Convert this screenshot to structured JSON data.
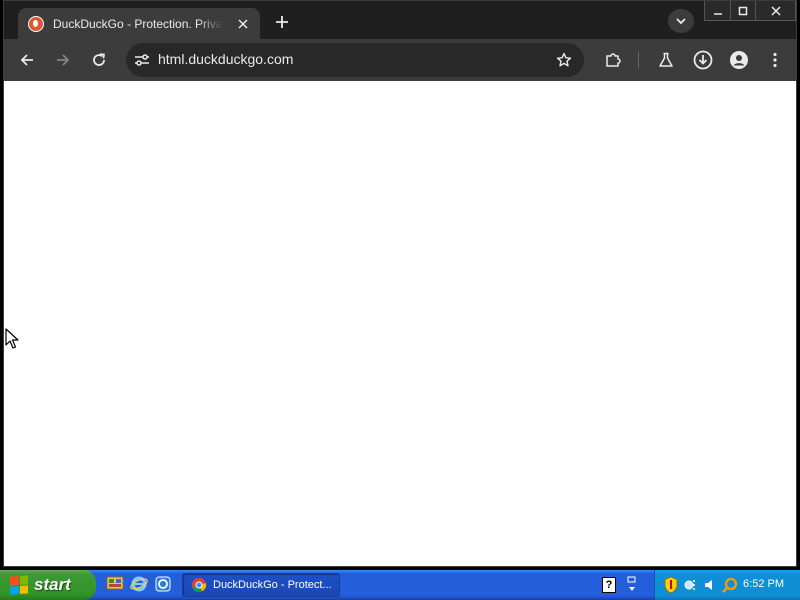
{
  "browser": {
    "tab": {
      "title": "DuckDuckGo - Protection. Privacy. Peace of mind.",
      "favicon": "duckduckgo-logo-icon",
      "brand_color": "#de5833"
    },
    "url": "html.duckduckgo.com",
    "toolbar_icons": [
      "back-arrow-icon",
      "forward-arrow-icon",
      "reload-icon",
      "site-info-icon",
      "bookmark-star-icon",
      "extensions-puzzle-icon",
      "labs-flask-icon",
      "download-icon",
      "profile-icon",
      "menu-kebab-icon"
    ],
    "colors": {
      "tabstrip": "#1f1f1f",
      "toolbar": "#3c3c3c",
      "omnibox": "#282828",
      "text": "#e8eaed",
      "viewport": "#ffffff"
    }
  },
  "taskbar": {
    "start_label": "start",
    "task_item_label": "DuckDuckGo - Protect...",
    "help_label": "?",
    "clock": "6:52 PM",
    "colors": {
      "bar": "#245edb",
      "start": "#3c9a34",
      "tray": "#0f8fd6"
    }
  }
}
